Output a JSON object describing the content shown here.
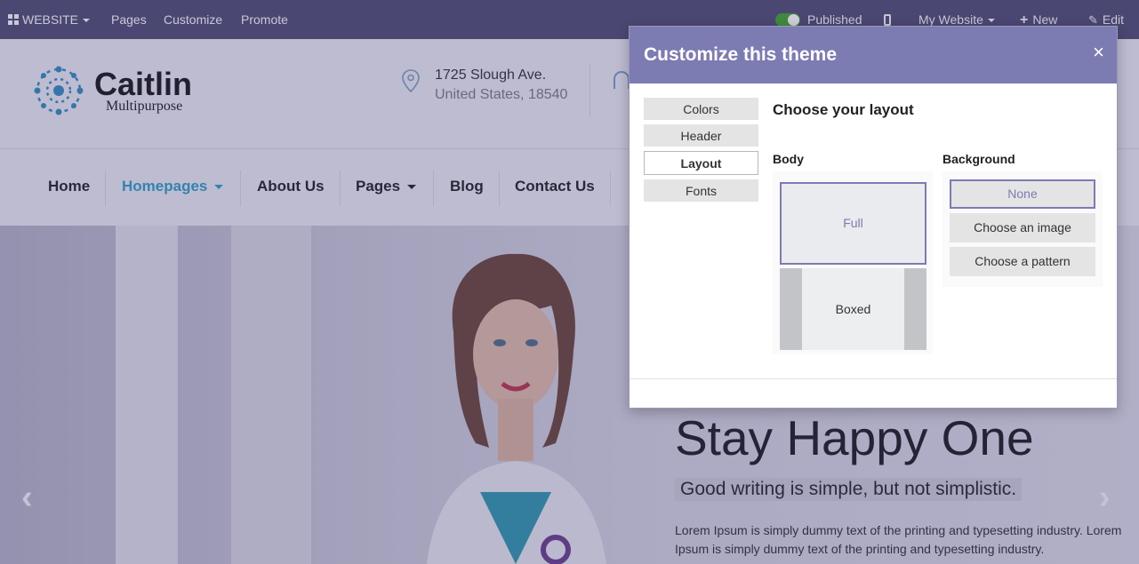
{
  "topbar": {
    "website_label": "WEBSITE",
    "pages_label": "Pages",
    "customize_label": "Customize",
    "promote_label": "Promote",
    "published_label": "Published",
    "site_selector_label": "My Website",
    "new_label": "New",
    "edit_label": "Edit"
  },
  "header": {
    "logo_name": "Caitlin",
    "logo_sub": "Multipurpose",
    "address_line1": "1725 Slough Ave.",
    "address_line2": "United States, 18540"
  },
  "nav": {
    "items": [
      "Home",
      "Homepages",
      "About Us",
      "Pages",
      "Blog",
      "Contact Us"
    ]
  },
  "hero": {
    "title": "Stay Happy One",
    "subtitle": "Good writing is simple, but not simplistic.",
    "body": "Lorem Ipsum is simply dummy text of the printing and typesetting industry. Lorem Ipsum is simply dummy text of the printing and typesetting industry."
  },
  "modal": {
    "title": "Customize this theme",
    "close": "×",
    "tabs": [
      "Colors",
      "Header",
      "Layout",
      "Fonts"
    ],
    "active_tab": "Layout",
    "section_title": "Choose your layout",
    "body_label": "Body",
    "body_options": [
      "Full",
      "Boxed"
    ],
    "background_label": "Background",
    "background_options": [
      "None",
      "Choose an image",
      "Choose a pattern"
    ]
  },
  "colors": {
    "topbar": "#4b4773",
    "modal_header": "#7c7bb2",
    "nav_active": "#2aa3c9",
    "logo_blue": "#2b8fc4"
  }
}
